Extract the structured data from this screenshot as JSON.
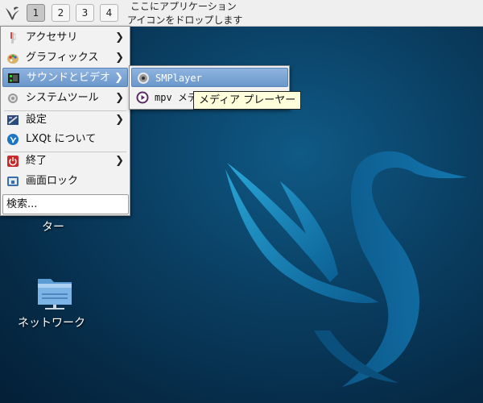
{
  "panel": {
    "desktops": [
      "1",
      "2",
      "3",
      "4"
    ],
    "active_desktop": "1",
    "quicklaunch_hint_line1": "ここにアプリケーション",
    "quicklaunch_hint_line2": "アイコンをドロップします"
  },
  "main_menu": {
    "items": [
      {
        "label": "アクセサリ",
        "icon": "accessories-icon",
        "submenu": true
      },
      {
        "label": "グラフィックス",
        "icon": "graphics-palette-icon",
        "submenu": true
      },
      {
        "label": "サウンドとビデオ",
        "icon": "multimedia-icon",
        "submenu": true,
        "highlighted": true
      },
      {
        "label": "システムツール",
        "icon": "system-gear-icon",
        "submenu": true
      },
      {
        "label": "設定",
        "icon": "preferences-icon",
        "submenu": true
      },
      {
        "label": "LXQt について",
        "icon": "lxqt-about-icon",
        "submenu": false
      },
      {
        "label": "終了",
        "icon": "power-icon",
        "submenu": true
      },
      {
        "label": "画面ロック",
        "icon": "lock-screen-icon",
        "submenu": false
      }
    ],
    "search_text": "検索..."
  },
  "sound_video_menu": {
    "items": [
      {
        "label": "SMPlayer",
        "icon": "smplayer-icon",
        "highlighted": true
      },
      {
        "label": "mpv メディア プレーヤー",
        "icon": "mpv-icon"
      }
    ]
  },
  "tooltip": "メディア プレーヤー",
  "desktop_icons": [
    {
      "label": "ター",
      "note": "partially hidden label"
    },
    {
      "label": "ネットワーク",
      "icon": "network-folder-icon"
    }
  ],
  "colors": {
    "highlight": "#6a97cb",
    "panel": "#efefef",
    "desktop": "#0a3f63"
  }
}
